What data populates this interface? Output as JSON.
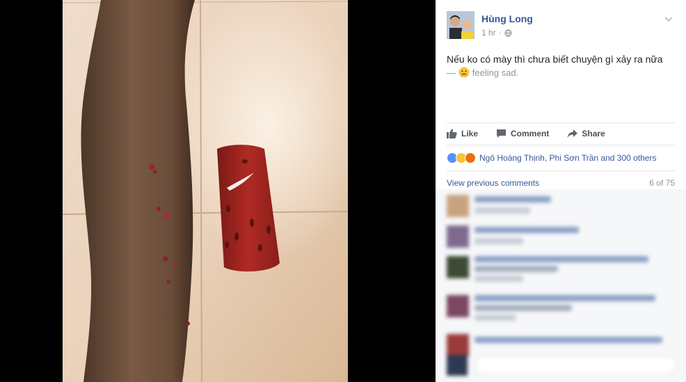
{
  "post": {
    "author": "Hùng Long",
    "time": "1 hr",
    "text": "Nếu ko có mày thì chưa biết chuyện gì xảy ra nữa",
    "feeling_prefix": "—",
    "feeling": "feeling sad."
  },
  "actions": {
    "like": "Like",
    "comment": "Comment",
    "share": "Share"
  },
  "reactions": {
    "types": [
      "like-reaction-icon",
      "sad-reaction-icon",
      "angry-reaction-icon"
    ],
    "names": "Ngô Hoàng Thịnh, Phi Sơn Trần and 300 others"
  },
  "comments": {
    "view_previous": "View previous comments",
    "count": "6 of 75"
  },
  "colors": {
    "link": "#365899",
    "text": "#1d2129",
    "muted": "#90949c",
    "background": "#000000"
  }
}
